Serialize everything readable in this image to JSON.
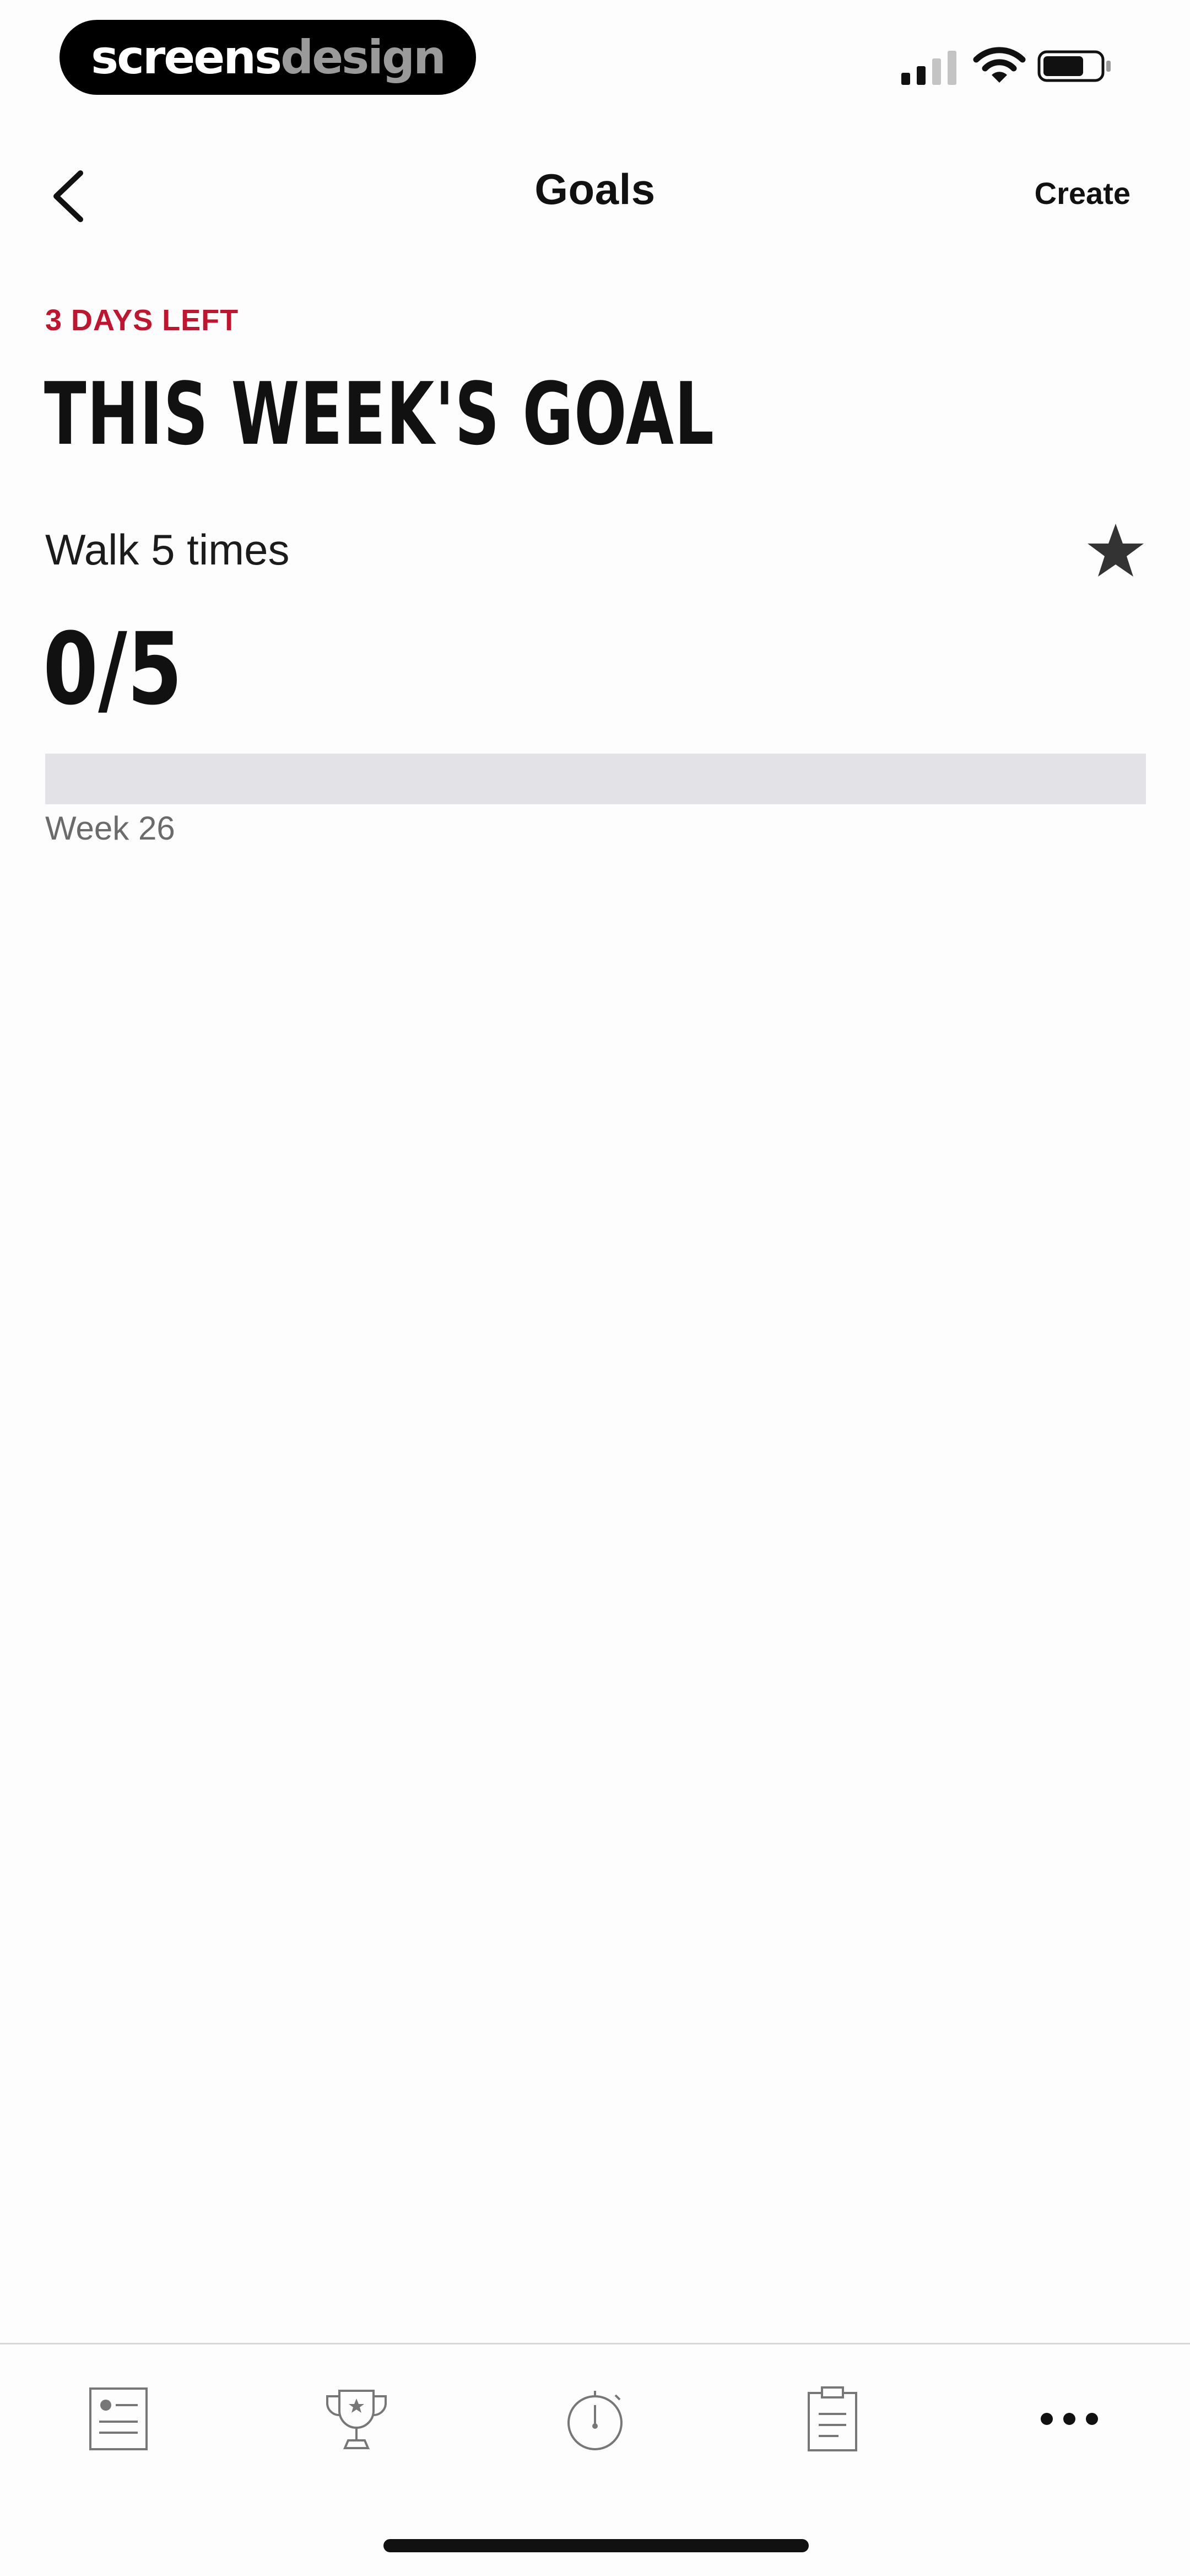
{
  "watermark": {
    "part1": "screens",
    "part2": "design"
  },
  "nav": {
    "title": "Goals",
    "create_label": "Create"
  },
  "goal": {
    "days_left": "3 DAYS LEFT",
    "heading": "THIS WEEK'S GOAL",
    "description": "Walk 5 times",
    "progress_text": "0/5",
    "progress_fraction": 0,
    "week_label": "Week 26"
  },
  "tabs": [
    {
      "name": "activity",
      "icon": "list-card-icon"
    },
    {
      "name": "achievements",
      "icon": "trophy-icon"
    },
    {
      "name": "run",
      "icon": "stopwatch-icon"
    },
    {
      "name": "plans",
      "icon": "clipboard-icon"
    },
    {
      "name": "more",
      "icon": "more-dots-icon"
    }
  ],
  "colors": {
    "accent": "#c0142f",
    "track": "#e3e3e7",
    "text": "#111111"
  }
}
